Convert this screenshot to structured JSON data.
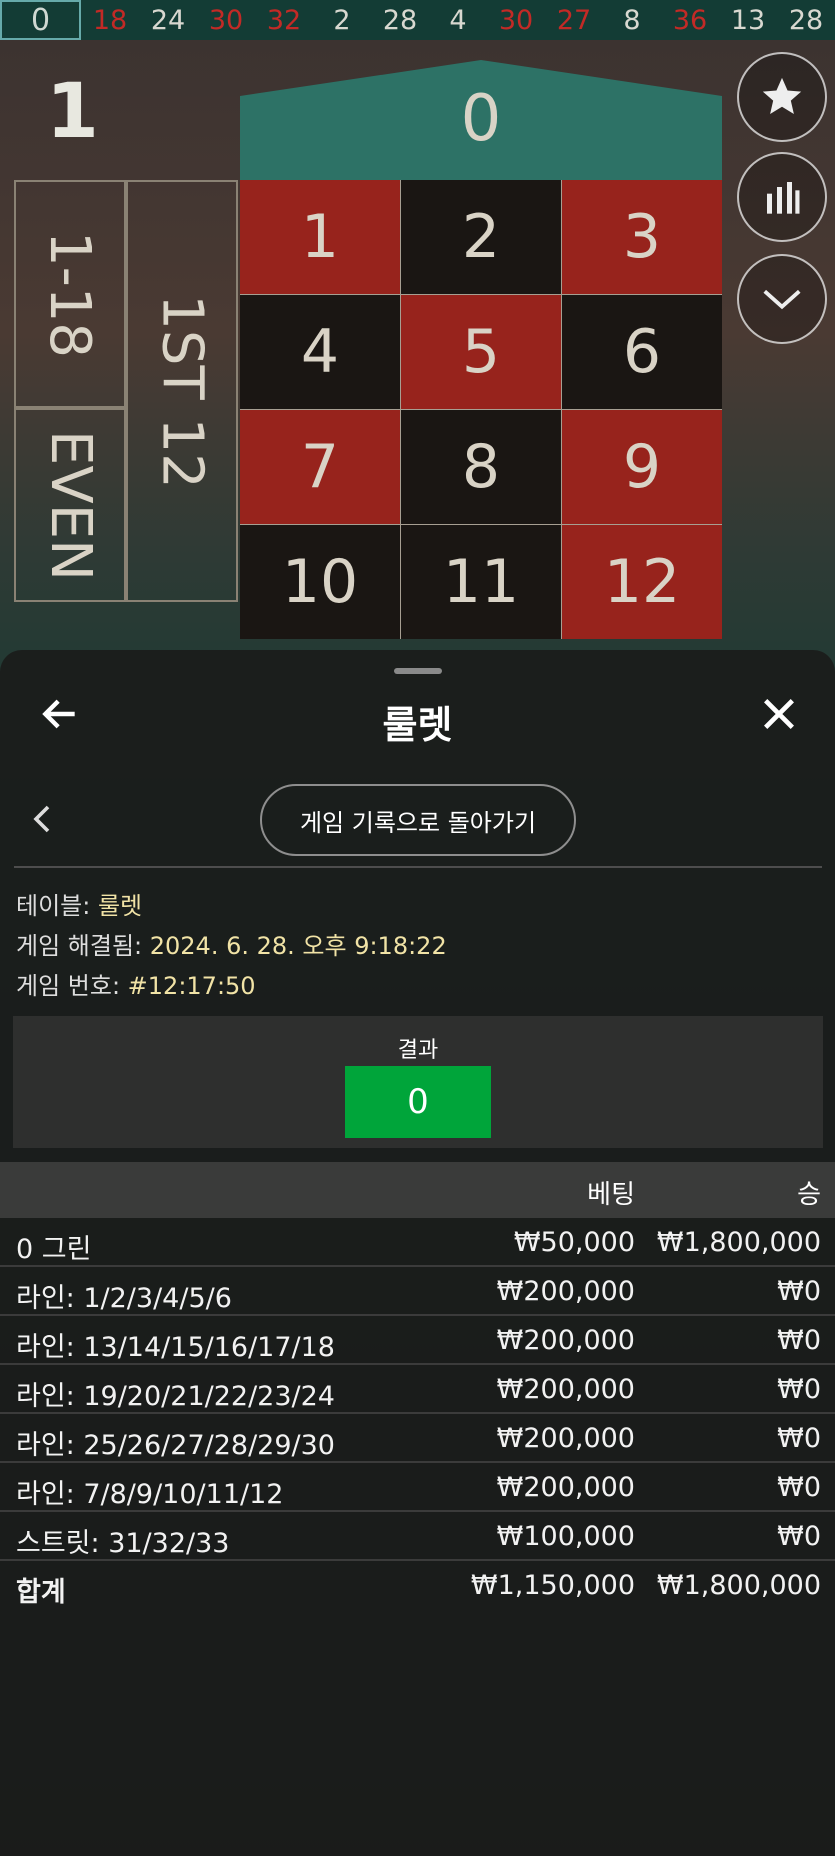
{
  "history_bar": {
    "current": "0",
    "numbers": [
      {
        "n": "18",
        "red": true
      },
      {
        "n": "24",
        "red": false
      },
      {
        "n": "30",
        "red": true
      },
      {
        "n": "32",
        "red": true
      },
      {
        "n": "2",
        "red": false
      },
      {
        "n": "28",
        "red": false
      },
      {
        "n": "4",
        "red": false
      },
      {
        "n": "30",
        "red": true
      },
      {
        "n": "27",
        "red": true
      },
      {
        "n": "8",
        "red": false
      },
      {
        "n": "36",
        "red": true
      },
      {
        "n": "13",
        "red": false
      },
      {
        "n": "28",
        "red": false
      }
    ]
  },
  "round_number": "1",
  "table": {
    "zero": "0",
    "numbers": [
      {
        "n": "1",
        "c": "r"
      },
      {
        "n": "2",
        "c": "b"
      },
      {
        "n": "3",
        "c": "r"
      },
      {
        "n": "4",
        "c": "b"
      },
      {
        "n": "5",
        "c": "r"
      },
      {
        "n": "6",
        "c": "b"
      },
      {
        "n": "7",
        "c": "r"
      },
      {
        "n": "8",
        "c": "b"
      },
      {
        "n": "9",
        "c": "r"
      },
      {
        "n": "10",
        "c": "b"
      },
      {
        "n": "11",
        "c": "b"
      },
      {
        "n": "12",
        "c": "r"
      }
    ],
    "side_1_18": "1-18",
    "side_even": "EVEN",
    "dozen_1st": "1ST 12"
  },
  "sheet": {
    "title": "룰렛",
    "history_button": "게임 기록으로 돌아가기",
    "info": {
      "table_label": "테이블: ",
      "table_value": "룰렛",
      "resolved_label": "게임 해결됨: ",
      "resolved_value": "2024. 6. 28. 오후 9:18:22",
      "game_no_label": "게임 번호: ",
      "game_no_value": "#12:17:50"
    },
    "result": {
      "label": "결과",
      "number": "0",
      "color": "#00a53a"
    },
    "bets": {
      "header_bet": "베팅",
      "header_win": "승",
      "rows": [
        {
          "name": "0 그린",
          "bet": "₩50,000",
          "win": "₩1,800,000"
        },
        {
          "name": "라인: 1/2/3/4/5/6",
          "bet": "₩200,000",
          "win": "₩0"
        },
        {
          "name": "라인: 13/14/15/16/17/18",
          "bet": "₩200,000",
          "win": "₩0"
        },
        {
          "name": "라인: 19/20/21/22/23/24",
          "bet": "₩200,000",
          "win": "₩0"
        },
        {
          "name": "라인: 25/26/27/28/29/30",
          "bet": "₩200,000",
          "win": "₩0"
        },
        {
          "name": "라인: 7/8/9/10/11/12",
          "bet": "₩200,000",
          "win": "₩0"
        },
        {
          "name": "스트릿: 31/32/33",
          "bet": "₩100,000",
          "win": "₩0"
        }
      ],
      "total": {
        "name": "합계",
        "bet": "₩1,150,000",
        "win": "₩1,800,000"
      }
    }
  },
  "colors": {
    "red_cell": "#97231c",
    "black_cell": "#1a1613",
    "green": "#2d7266",
    "info_value": "#f1e3a6"
  }
}
